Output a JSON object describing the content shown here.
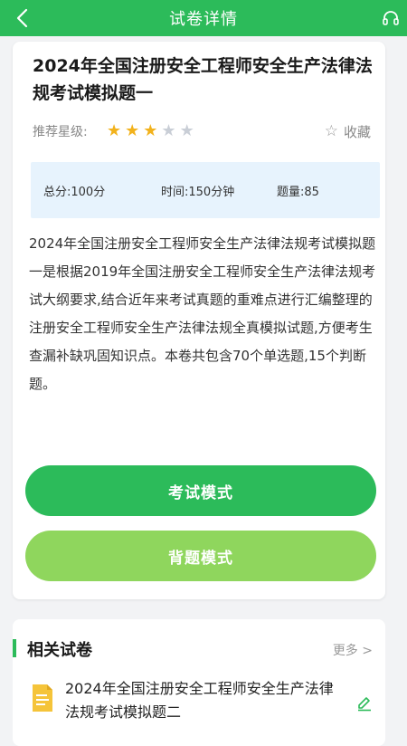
{
  "header": {
    "title": "试卷详情",
    "back_icon": "back-arrow-icon",
    "right_icon": "headset-icon",
    "bg_color": "#2cbb5a"
  },
  "paper": {
    "title": "2024年全国注册安全工程师安全生产法律法规考试模拟题一",
    "rating_label": "推荐星级:",
    "rating": 3,
    "rating_max": 5,
    "favorite_label": "收藏",
    "stats": {
      "score": "总分:100分",
      "time": "时间:150分钟",
      "count": "题量:85"
    },
    "description": "2024年全国注册安全工程师安全生产法律法规考试模拟题一是根据2019年全国注册安全工程师安全生产法律法规考试大纲要求,结合近年来考试真题的重难点进行汇编整理的注册安全工程师安全生产法律法规全真模拟试题,方便考生查漏补缺巩固知识点。本卷共包含70个单选题,15个判断题。"
  },
  "actions": {
    "exam_mode": "考试模式",
    "recite_mode": "背题模式"
  },
  "related": {
    "heading": "相关试卷",
    "more": "更多 >",
    "items": [
      {
        "title": "2024年全国注册安全工程师安全生产法律法规考试模拟题二"
      }
    ]
  }
}
